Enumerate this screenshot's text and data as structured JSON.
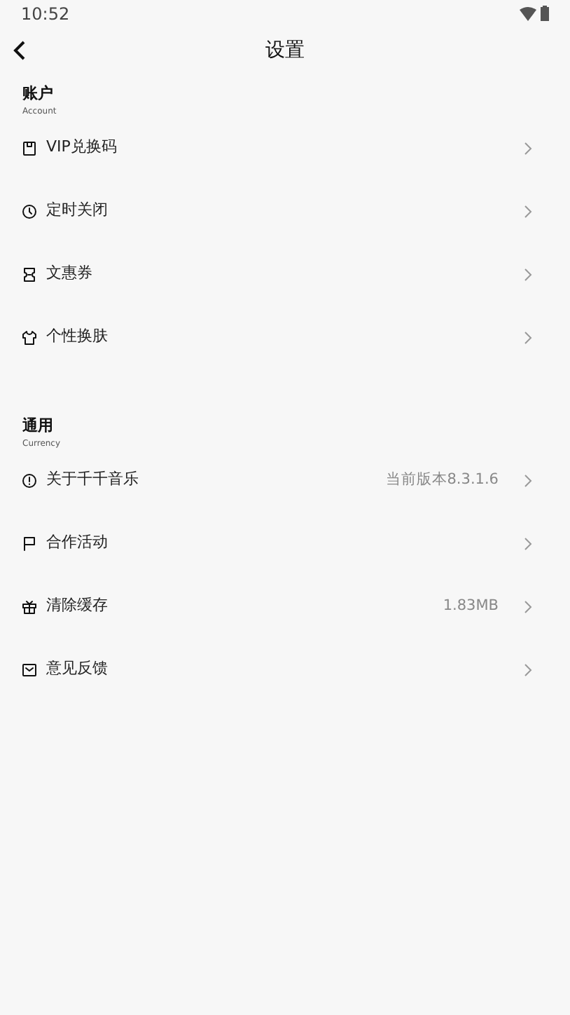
{
  "status_bar": {
    "time": "10:52"
  },
  "header": {
    "title": "设置"
  },
  "sections": [
    {
      "title": "账户",
      "subtitle": "Account",
      "items": [
        {
          "label": "VIP兑换码"
        },
        {
          "label": "定时关闭"
        },
        {
          "label": "文惠券"
        },
        {
          "label": "个性换肤"
        }
      ]
    },
    {
      "title": "通用",
      "subtitle": "Currency",
      "items": [
        {
          "label": "关于千千音乐",
          "value": "当前版本8.3.1.6"
        },
        {
          "label": "合作活动"
        },
        {
          "label": "清除缓存",
          "value": "1.83MB"
        },
        {
          "label": "意见反馈"
        }
      ]
    }
  ]
}
